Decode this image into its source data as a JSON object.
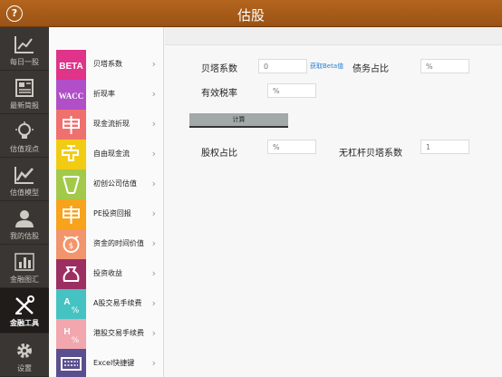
{
  "header": {
    "title": "估股",
    "help_icon": "?"
  },
  "nav": [
    {
      "label": "每日一股",
      "icon": "trend-chart-icon"
    },
    {
      "label": "最新简报",
      "icon": "newspaper-icon"
    },
    {
      "label": "估值观点",
      "icon": "lightbulb-icon"
    },
    {
      "label": "估值模型",
      "icon": "line-chart-icon"
    },
    {
      "label": "我的估股",
      "icon": "user-icon"
    },
    {
      "label": "金融图汇",
      "icon": "bar-chart-icon"
    },
    {
      "label": "金融工具",
      "icon": "tools-icon",
      "active": true
    },
    {
      "label": "设置",
      "icon": "gear-icon"
    }
  ],
  "tools": [
    {
      "label": "贝塔系数",
      "tile_text": "BETA",
      "color": "#e0338a"
    },
    {
      "label": "折现率",
      "tile_text": "WACC",
      "color": "#b04fc8"
    },
    {
      "label": "现金流折现",
      "tile_text": "",
      "color": "#f0706e"
    },
    {
      "label": "自由现金流",
      "tile_text": "",
      "color": "#f2cc12"
    },
    {
      "label": "初创公司估值",
      "tile_text": "",
      "color": "#a3c94a"
    },
    {
      "label": "PE投资回报",
      "tile_text": "",
      "color": "#f7a31c"
    },
    {
      "label": "资金的时间价值",
      "tile_text": "",
      "color": "#f2946c"
    },
    {
      "label": "投资收益",
      "tile_text": "",
      "color": "#9c2e62"
    },
    {
      "label": "A股交易手续费",
      "tile_text": "",
      "color": "#45c3c2"
    },
    {
      "label": "港股交易手续费",
      "tile_text": "",
      "color": "#f2a6ae"
    },
    {
      "label": "Excel快捷键",
      "tile_text": "",
      "color": "#5a4f8e"
    }
  ],
  "form": {
    "beta_label": "贝塔系数",
    "beta_value": "0",
    "get_beta_link": "获取Beta值",
    "debt_ratio_label": "债务占比",
    "debt_ratio_placeholder": "%",
    "tax_rate_label": "有效税率",
    "tax_rate_placeholder": "%",
    "calc_button": "计算",
    "equity_ratio_label": "股权占比",
    "equity_ratio_placeholder": "%",
    "unlevered_beta_label": "无杠杆贝塔系数",
    "unlevered_beta_value": "1"
  }
}
